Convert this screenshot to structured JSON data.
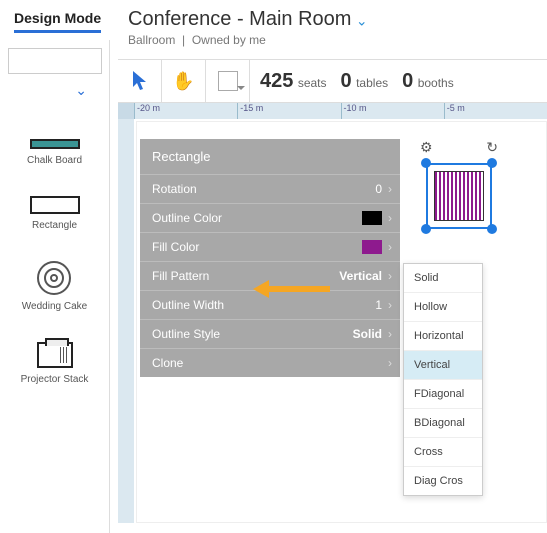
{
  "design_mode_label": "Design Mode",
  "header": {
    "title": "Conference - Main Room",
    "sub_location": "Ballroom",
    "sub_owner": "Owned by me"
  },
  "counts": {
    "seats_num": "425",
    "seats_lbl": "seats",
    "tables_num": "0",
    "tables_lbl": "tables",
    "booths_num": "0",
    "booths_lbl": "booths"
  },
  "palette": {
    "chalk": "Chalk Board",
    "rect": "Rectangle",
    "cake": "Wedding Cake",
    "proj": "Projector Stack"
  },
  "ruler": [
    "-20 m",
    "-15 m",
    "-10 m",
    "-5 m"
  ],
  "props": {
    "title": "Rectangle",
    "rotation_lbl": "Rotation",
    "rotation_val": "0",
    "outline_color_lbl": "Outline Color",
    "fill_color_lbl": "Fill Color",
    "fill_pattern_lbl": "Fill Pattern",
    "fill_pattern_val": "Vertical",
    "outline_width_lbl": "Outline Width",
    "outline_width_val": "1",
    "outline_style_lbl": "Outline Style",
    "outline_style_val": "Solid",
    "clone_lbl": "Clone"
  },
  "dropdown": [
    "Solid",
    "Hollow",
    "Horizontal",
    "Vertical",
    "FDiagonal",
    "BDiagonal",
    "Cross",
    "Diag Cros"
  ],
  "dropdown_selected": "Vertical"
}
